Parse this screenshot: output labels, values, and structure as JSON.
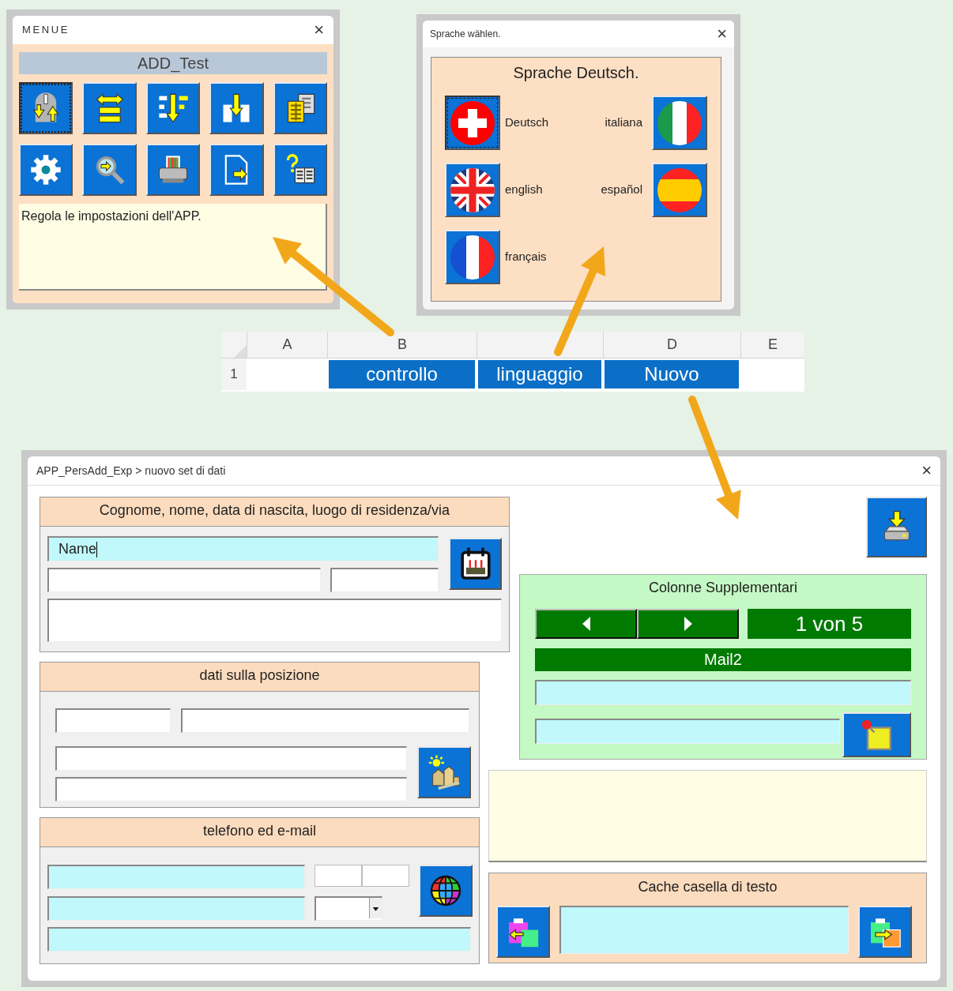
{
  "menu_window": {
    "title": "MENUE",
    "close": "×",
    "app_name": "ADD_Test",
    "buttons": [
      {
        "kind": "swap",
        "selected": true
      },
      {
        "kind": "list-swap",
        "selected": false
      },
      {
        "kind": "sort-down",
        "selected": false
      },
      {
        "kind": "merge-down",
        "selected": false
      },
      {
        "kind": "sheets",
        "selected": false
      },
      {
        "kind": "gear",
        "selected": false
      },
      {
        "kind": "search",
        "selected": false
      },
      {
        "kind": "printer",
        "selected": false
      },
      {
        "kind": "export",
        "selected": false
      },
      {
        "kind": "help",
        "selected": false
      }
    ],
    "description": "Regola le impostazioni dell'APP."
  },
  "language_window": {
    "title": "Sprache wählen.",
    "close": "×",
    "heading": "Sprache Deutsch.",
    "languages": [
      {
        "label": "Deutsch",
        "kind": "swiss",
        "selected": true
      },
      {
        "label": "italiana",
        "kind": "italy",
        "selected": false
      },
      {
        "label": "english",
        "kind": "uk",
        "selected": false
      },
      {
        "label": "español",
        "kind": "spain",
        "selected": false
      },
      {
        "label": "français",
        "kind": "france",
        "selected": false
      }
    ]
  },
  "spreadsheet": {
    "row_header": "1",
    "columns": [
      {
        "header": "A"
      },
      {
        "header": "B",
        "cell": "controllo"
      },
      {
        "cell": "linguaggio"
      },
      {
        "header": "D",
        "cell": "Nuovo"
      },
      {
        "header": "E"
      }
    ]
  },
  "form_window": {
    "title": "APP_PersAdd_Exp > nuovo set di dati",
    "close": "×",
    "name_section": {
      "heading": "Cognome, nome, data di nascita, luogo di residenza/via",
      "name_value": "Name"
    },
    "location_section": {
      "heading": "dati sulla posizione"
    },
    "contact_section": {
      "heading": "telefono ed e-mail"
    },
    "extra_columns": {
      "heading": "Colonne Supplementari",
      "counter": "1 von 5",
      "column_name": "Mail2"
    },
    "cache_section": {
      "heading": "Cache casella di testo"
    }
  }
}
